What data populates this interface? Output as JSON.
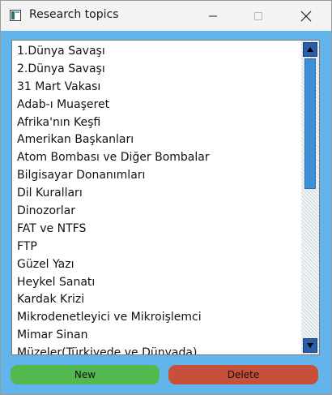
{
  "window": {
    "title": "Research topics"
  },
  "topics": [
    "1.Dünya Savaşı",
    "2.Dünya Savaşı",
    "31 Mart Vakası",
    "Adab-ı Muaşeret",
    "Afrika'nın Keşfi",
    "Amerikan Başkanları",
    "Atom Bombası ve Diğer Bombalar",
    "Bilgisayar Donanımları",
    "Dil Kuralları",
    "Dinozorlar",
    "FAT ve NTFS",
    "FTP",
    "Güzel Yazı",
    "Heykel Sanatı",
    "Kardak Krizi",
    "Mikrodenetleyici ve Mikroişlemci",
    "Mimar Sinan",
    "Müzeler(Türkiyede ve Dünyada)"
  ],
  "buttons": {
    "new_label": "New",
    "delete_label": "Delete"
  },
  "colors": {
    "window_background": "#62b4ea",
    "new_button": "#53b84e",
    "delete_button": "#c7503a",
    "scrollbar_thumb": "#3f8fd6"
  }
}
